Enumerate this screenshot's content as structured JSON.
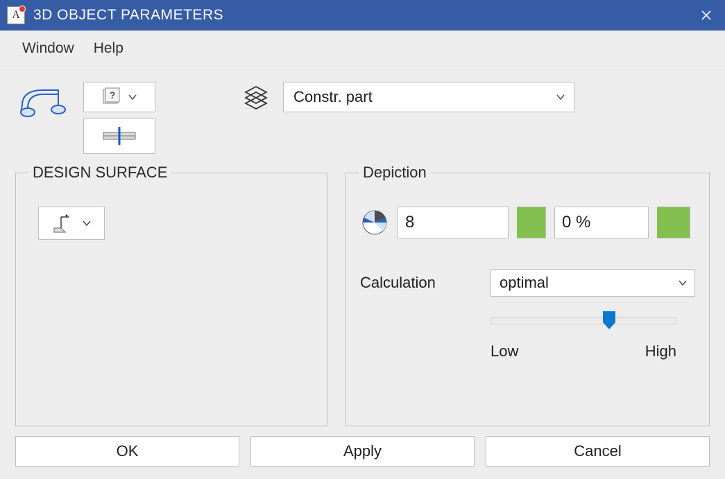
{
  "title": "3D OBJECT PARAMETERS",
  "menu": {
    "window": "Window",
    "help": "Help"
  },
  "layer_select": {
    "value": "Constr. part"
  },
  "groups": {
    "design_surface": "DESIGN SURFACE",
    "depiction": "Depiction"
  },
  "depiction": {
    "segments_value": "8",
    "transparency_value": "0 %",
    "swatch_color_1": "#83bf4f",
    "swatch_color_2": "#83bf4f"
  },
  "calculation": {
    "label": "Calculation",
    "value": "optimal",
    "slider_low": "Low",
    "slider_high": "High",
    "slider_percent": 64
  },
  "buttons": {
    "ok": "OK",
    "apply": "Apply",
    "cancel": "Cancel"
  }
}
